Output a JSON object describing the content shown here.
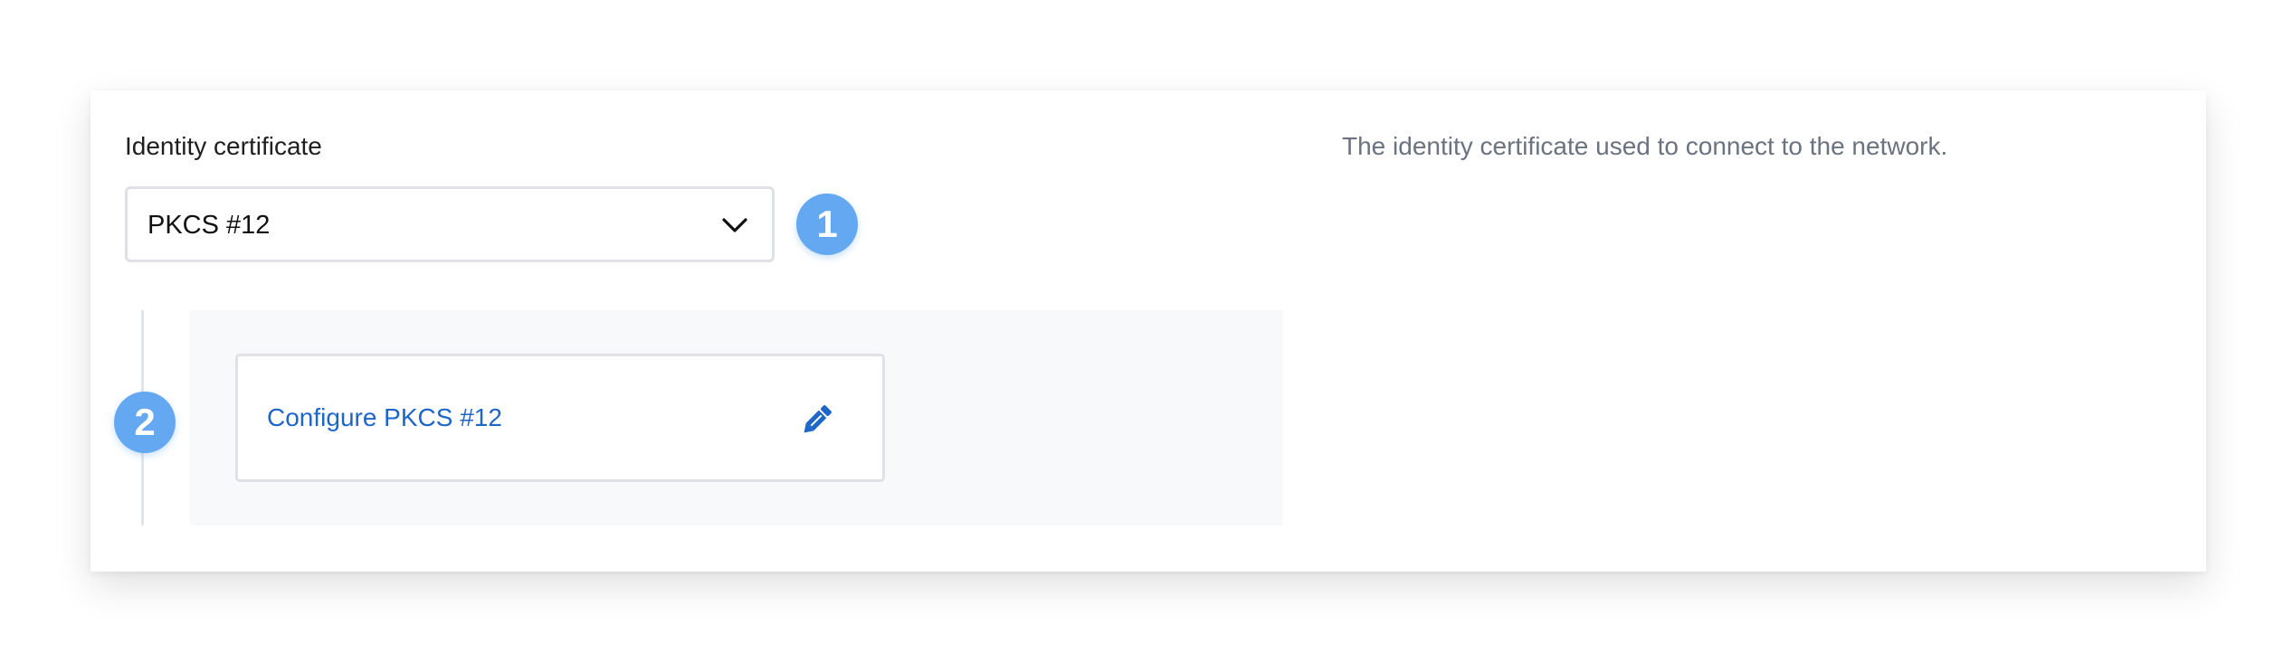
{
  "field": {
    "label": "Identity certificate",
    "description": "The identity certificate used to connect to the network."
  },
  "select": {
    "value": "PKCS #12",
    "icon": "chevron-down-icon"
  },
  "badges": {
    "first": "1",
    "second": "2"
  },
  "config": {
    "link_label": "Configure PKCS #12",
    "icon": "pencil-icon"
  },
  "colors": {
    "badge": "#64a8f2",
    "link": "#1f66c9",
    "border": "#dfe1e6",
    "panel": "#f8f9fb",
    "description": "#6b7280"
  }
}
